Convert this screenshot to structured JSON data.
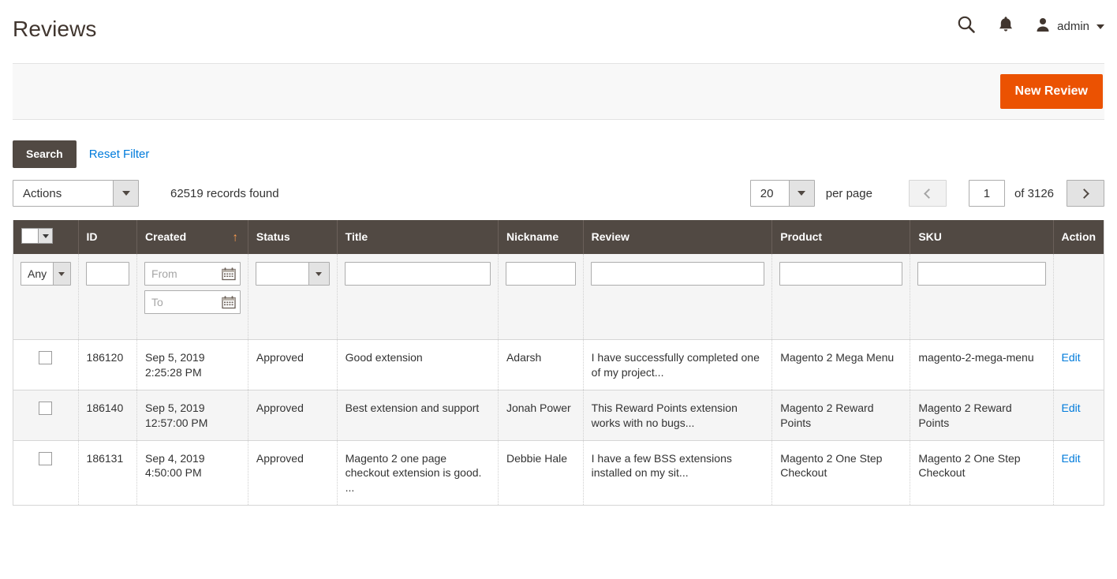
{
  "header": {
    "title": "Reviews",
    "search_icon": "search-icon",
    "notifications_icon": "bell-icon",
    "avatar_icon": "user-avatar-icon",
    "admin_name": "admin",
    "caret_icon": "chevron-down-icon"
  },
  "page_actions": {
    "new_review_label": "New Review"
  },
  "toolbar": {
    "search_label": "Search",
    "reset_filter_label": "Reset Filter",
    "actions_label": "Actions",
    "records_found": "62519 records found",
    "per_page_value": "20",
    "per_page_label": "per page",
    "prev_icon": "chevron-left-icon",
    "next_icon": "chevron-right-icon",
    "page_value": "1",
    "page_of": "of 3126"
  },
  "grid": {
    "columns": [
      {
        "key": "check",
        "label": ""
      },
      {
        "key": "id",
        "label": "ID"
      },
      {
        "key": "created",
        "label": "Created"
      },
      {
        "key": "status",
        "label": "Status"
      },
      {
        "key": "title",
        "label": "Title"
      },
      {
        "key": "nickname",
        "label": "Nickname"
      },
      {
        "key": "review",
        "label": "Review"
      },
      {
        "key": "product",
        "label": "Product"
      },
      {
        "key": "sku",
        "label": "SKU"
      },
      {
        "key": "action",
        "label": "Action"
      }
    ],
    "sorted_column": "Created",
    "sort_direction": "asc",
    "sort_arrow_glyph": "↑",
    "filters": {
      "massaction_value": "Any",
      "id_value": "",
      "created_from_placeholder": "From",
      "created_to_placeholder": "To",
      "created_from_value": "",
      "created_to_value": "",
      "status_value": "",
      "title_value": "",
      "nickname_value": "",
      "review_value": "",
      "product_value": "",
      "sku_value": "",
      "calendar_icon": "calendar-icon"
    },
    "rows": [
      {
        "id": "186120",
        "created": "Sep 5, 2019 2:25:28 PM",
        "status": "Approved",
        "title": "Good extension",
        "nickname": "Adarsh",
        "review": "I have successfully completed one of my project...",
        "product": "Magento 2 Mega Menu",
        "sku": "magento-2-mega-menu",
        "action": "Edit"
      },
      {
        "id": "186140",
        "created": "Sep 5, 2019 12:57:00 PM",
        "status": "Approved",
        "title": "Best extension and support",
        "nickname": "Jonah Power",
        "review": "This Reward Points extension works with no bugs...",
        "product": "Magento 2 Reward Points",
        "sku": "Magento 2 Reward Points",
        "action": "Edit"
      },
      {
        "id": "186131",
        "created": "Sep 4, 2019 4:50:00 PM",
        "status": "Approved",
        "title": "Magento 2 one page checkout extension is good. ...",
        "nickname": "Debbie Hale",
        "review": "I have a few BSS extensions installed on my sit...",
        "product": "Magento 2 One Step Checkout",
        "sku": "Magento 2 One Step Checkout",
        "action": "Edit"
      }
    ]
  },
  "colors": {
    "primary_button": "#eb5202",
    "header_dark": "#514943",
    "link_blue": "#007bdb",
    "sort_arrow": "#ff9e4e"
  }
}
